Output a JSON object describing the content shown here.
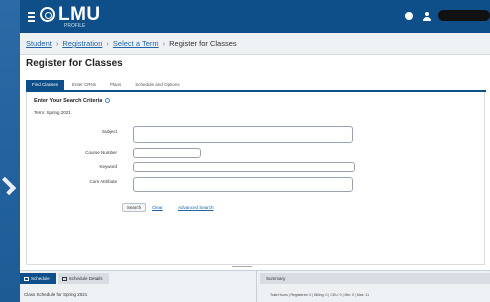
{
  "header": {
    "logo": "LMU",
    "logo_subtitle": "PROFILE"
  },
  "breadcrumb": {
    "items": [
      "Student",
      "Registration",
      "Select a Term"
    ],
    "current": "Register for Classes"
  },
  "page_title": "Register for Classes",
  "tabs": [
    "Find Classes",
    "Enter CRNs",
    "Plans",
    "Schedule and Options"
  ],
  "search": {
    "heading": "Enter Your Search Criteria",
    "term": "Term: Spring 2021",
    "fields": {
      "subject_label": "Subject",
      "course_number_label": "Course Number",
      "keyword_label": "Keyword",
      "core_attribute_label": "Core Attribute"
    },
    "search_button": "Search",
    "clear_link": "Clear",
    "advanced_link": "Advanced Search"
  },
  "bottom": {
    "schedule_tab": "Schedule",
    "schedule_details_tab": "Schedule Details",
    "schedule_for": "Class Schedule for Spring 2021",
    "summary_tab": "Summary",
    "summary_text": "Total Hours | Registered: 0 | Billing: 0 | CEU: 0 | Min: 0 | Max: 11"
  },
  "colors": {
    "brand": "#0e4f8a",
    "link": "#2366a8",
    "bezel": "#1f5f9a"
  }
}
